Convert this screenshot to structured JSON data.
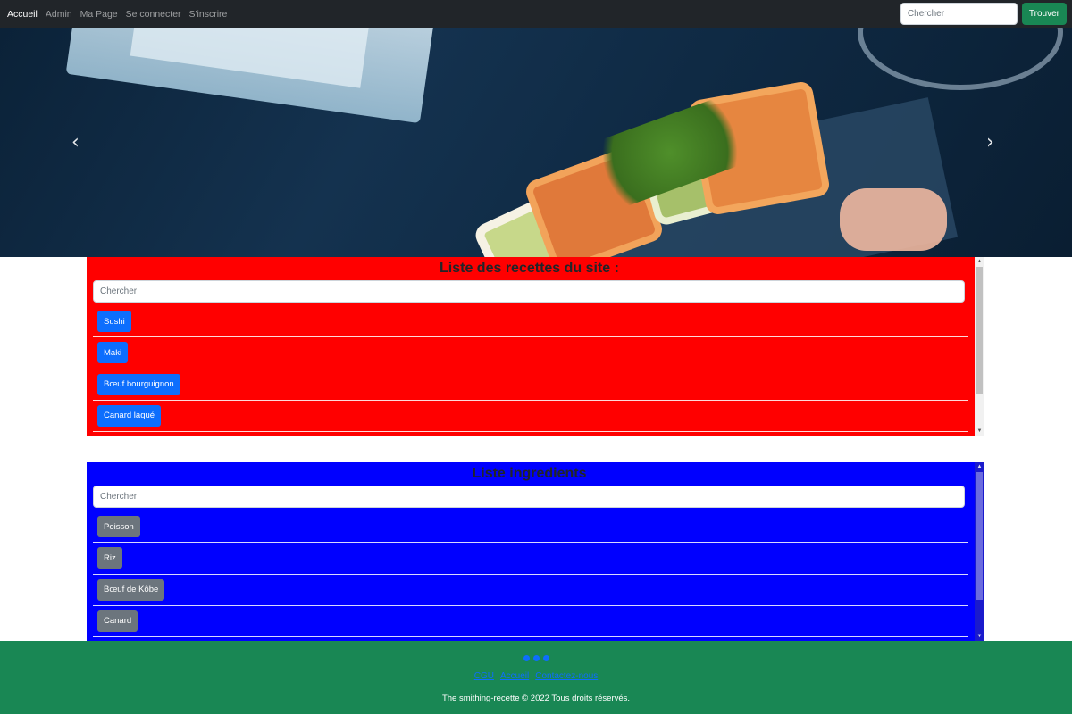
{
  "navbar": {
    "links": [
      {
        "label": "Accueil",
        "active": true
      },
      {
        "label": "Admin",
        "active": false
      },
      {
        "label": "Ma Page",
        "active": false
      },
      {
        "label": "Se connecter",
        "active": false
      },
      {
        "label": "S'inscrire",
        "active": false
      }
    ],
    "search_placeholder": "Chercher",
    "search_button": "Trouver"
  },
  "carousel": {
    "prev_icon": "chevron-left-icon",
    "next_icon": "chevron-right-icon"
  },
  "recipes": {
    "title": "Liste des recettes du site :",
    "search_placeholder": "Chercher",
    "items": [
      "Sushi",
      "Maki",
      "Bœuf bourguignon",
      "Canard laqué",
      ""
    ],
    "background": "#ff0000",
    "button_color": "#0d6efd"
  },
  "ingredients": {
    "title": "Liste ingredients",
    "search_placeholder": "Chercher",
    "items": [
      "Poisson",
      "Riz",
      "Bœuf de Kôbe",
      "Canard",
      ""
    ],
    "background": "#0000ff",
    "button_color": "#6c757d"
  },
  "footer": {
    "social_icons": [
      "facebook-icon",
      "twitter-icon",
      "instagram-icon"
    ],
    "links": [
      "CGU",
      "Accueil",
      "Contactez-nous"
    ],
    "copyright": "The smithing-recette © 2022 Tous droits réservés.",
    "background": "#198754"
  }
}
